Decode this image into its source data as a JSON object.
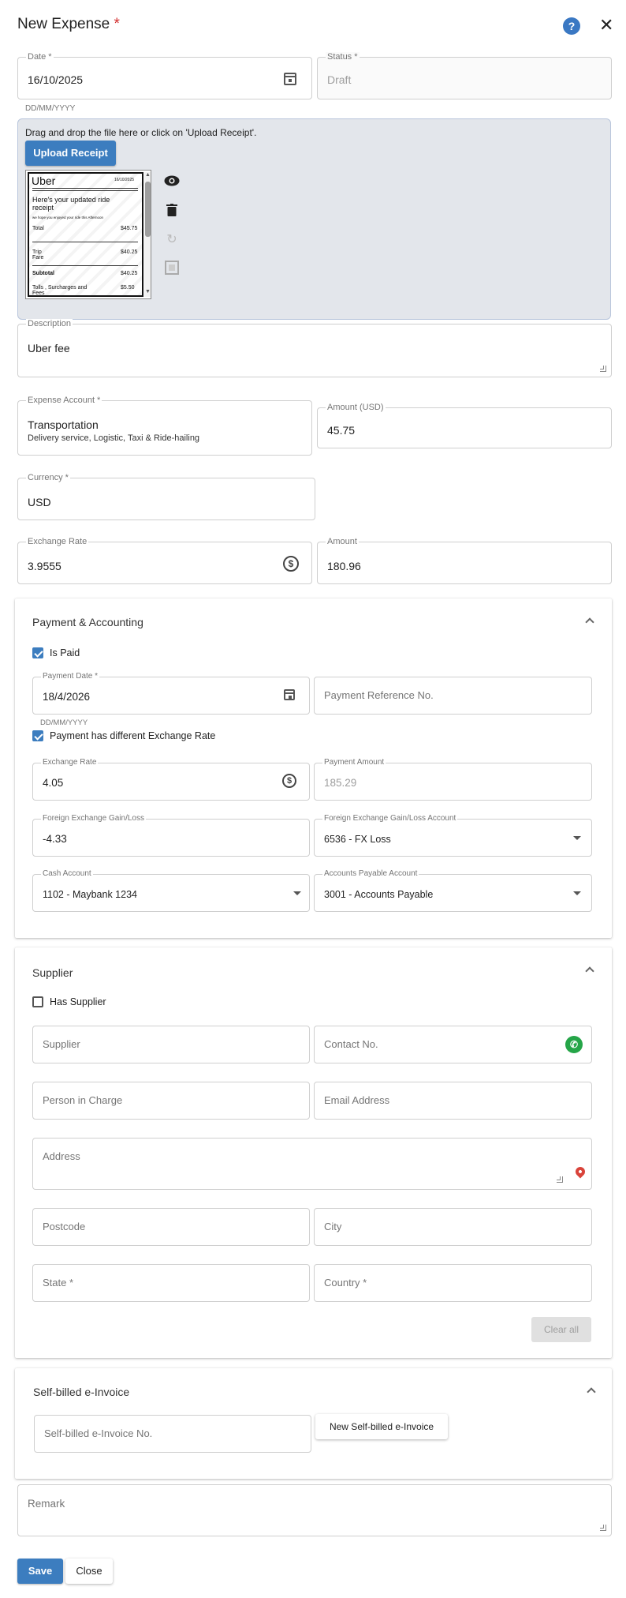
{
  "dialog": {
    "title": "New Expense",
    "required_mark": "*"
  },
  "date": {
    "label": "Date *",
    "value": "16/10/2025",
    "hint": "DD/MM/YYYY"
  },
  "status": {
    "label": "Status *",
    "value": "Draft"
  },
  "upload": {
    "instruction": "Drag and drop the file here or click on 'Upload Receipt'.",
    "button": "Upload Receipt"
  },
  "receipt_preview": {
    "brand": "Uber",
    "date": "16/10/2025",
    "heading": "Here's your updated ride receipt",
    "tagline": "we hope you enjoyed your ride this Afternoon",
    "total_label": "Total",
    "total_value": "$45.75",
    "trip_label": "Trip Fare",
    "trip_value": "$40.25",
    "subtotal_label": "Subtotal",
    "subtotal_value": "$40.25",
    "tolls_label": "Tolls , Surcharges and Fees",
    "tolls_value": "$5.50"
  },
  "description": {
    "label": "Description",
    "value": "Uber fee"
  },
  "expense_account": {
    "label": "Expense Account *",
    "value": "Transportation",
    "sub": "Delivery service, Logistic, Taxi & Ride-hailing"
  },
  "amount_usd": {
    "label": "Amount (USD)",
    "value": "45.75"
  },
  "currency": {
    "label": "Currency *",
    "value": "USD"
  },
  "exchange_rate": {
    "label": "Exchange Rate",
    "value": "3.9555"
  },
  "amount": {
    "label": "Amount",
    "value": "180.96"
  },
  "payment": {
    "title": "Payment & Accounting",
    "is_paid_label": "Is Paid",
    "is_paid": true,
    "payment_date": {
      "label": "Payment Date *",
      "value": "18/4/2026",
      "hint": "DD/MM/YYYY"
    },
    "payment_ref": {
      "placeholder": "Payment Reference No."
    },
    "diff_rate_label": "Payment has different Exchange Rate",
    "diff_rate": true,
    "exchange_rate": {
      "label": "Exchange Rate",
      "value": "4.05"
    },
    "payment_amount": {
      "label": "Payment Amount",
      "value": "185.29"
    },
    "fx_gain_loss": {
      "label": "Foreign Exchange Gain/Loss",
      "value": "-4.33"
    },
    "fx_account": {
      "label": "Foreign Exchange Gain/Loss Account",
      "value": "6536 - FX Loss"
    },
    "cash_account": {
      "label": "Cash Account",
      "value": "1102 - Maybank 1234"
    },
    "ap_account": {
      "label": "Accounts Payable Account",
      "value": "3001 - Accounts Payable"
    }
  },
  "supplier": {
    "title": "Supplier",
    "has_supplier_label": "Has Supplier",
    "has_supplier": false,
    "supplier_ph": "Supplier",
    "contact_ph": "Contact No.",
    "person_ph": "Person in Charge",
    "email_ph": "Email Address",
    "address_ph": "Address",
    "postcode_ph": "Postcode",
    "city_ph": "City",
    "state_ph": "State *",
    "country_ph": "Country *",
    "clear_all": "Clear all"
  },
  "einvoice": {
    "title": "Self-billed e-Invoice",
    "number_ph": "Self-billed e-Invoice No.",
    "new_button": "New Self-billed e-Invoice"
  },
  "remark": {
    "placeholder": "Remark"
  },
  "footer": {
    "save": "Save",
    "close": "Close"
  },
  "colors": {
    "primary": "#3c7dbf",
    "required": "#d32f2f",
    "whatsapp": "#25a548",
    "location": "#d9433a"
  }
}
